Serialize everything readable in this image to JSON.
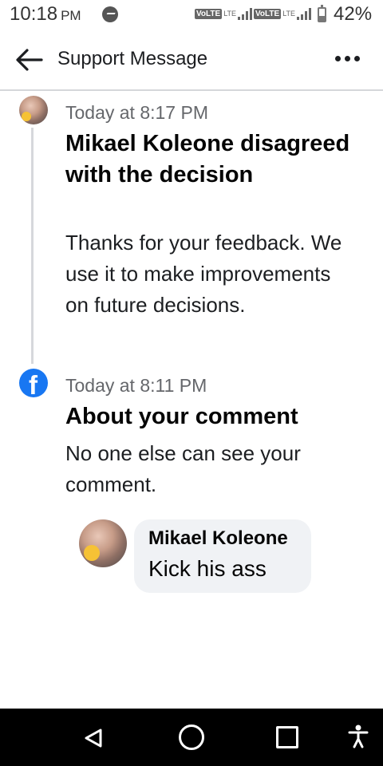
{
  "status_bar": {
    "time": "10:18",
    "ampm": "PM",
    "network_1": "VoLTE",
    "network_1_sub": "LTE",
    "network_2": "VoLTE",
    "network_2_sub": "LTE",
    "battery": "42%",
    "battery_level": 0.42
  },
  "header": {
    "title": "Support Message"
  },
  "messages": [
    {
      "timestamp": "Today at 8:17 PM",
      "title": "Mikael Koleone disagreed with the decision",
      "body": "Thanks for your feedback. We use it to make improvements on future decisions."
    },
    {
      "timestamp": "Today at 8:11 PM",
      "title": "About your comment",
      "body": "No one else can see your comment."
    }
  ],
  "comment": {
    "author": "Mikael Koleone",
    "text": "Kick his ass"
  },
  "icons": {
    "back": "arrow-left-icon",
    "more": "more-horizontal-icon",
    "facebook": "facebook-icon",
    "nav_back": "triangle-back-icon",
    "nav_home": "circle-home-icon",
    "nav_recent": "square-recent-icon",
    "nav_accessibility": "accessibility-icon"
  },
  "colors": {
    "facebook_blue": "#1877f2",
    "bubble_bg": "#f0f2f5",
    "timestamp": "#65676b"
  }
}
